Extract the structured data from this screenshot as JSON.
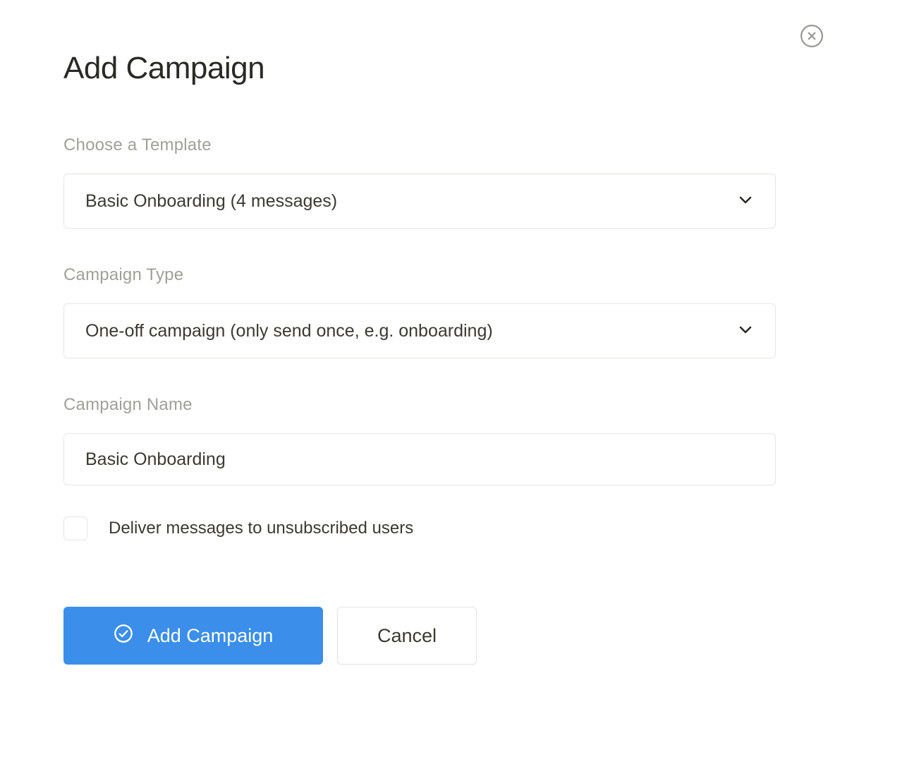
{
  "modal": {
    "title": "Add Campaign",
    "close_label": "Close"
  },
  "form": {
    "template": {
      "label": "Choose a Template",
      "value": "Basic Onboarding (4 messages)"
    },
    "campaign_type": {
      "label": "Campaign Type",
      "value": "One-off campaign (only send once, e.g. onboarding)"
    },
    "campaign_name": {
      "label": "Campaign Name",
      "value": "Basic Onboarding"
    },
    "deliver_unsubscribed": {
      "label": "Deliver messages to unsubscribed users",
      "checked": false
    }
  },
  "buttons": {
    "primary": "Add Campaign",
    "secondary": "Cancel"
  }
}
